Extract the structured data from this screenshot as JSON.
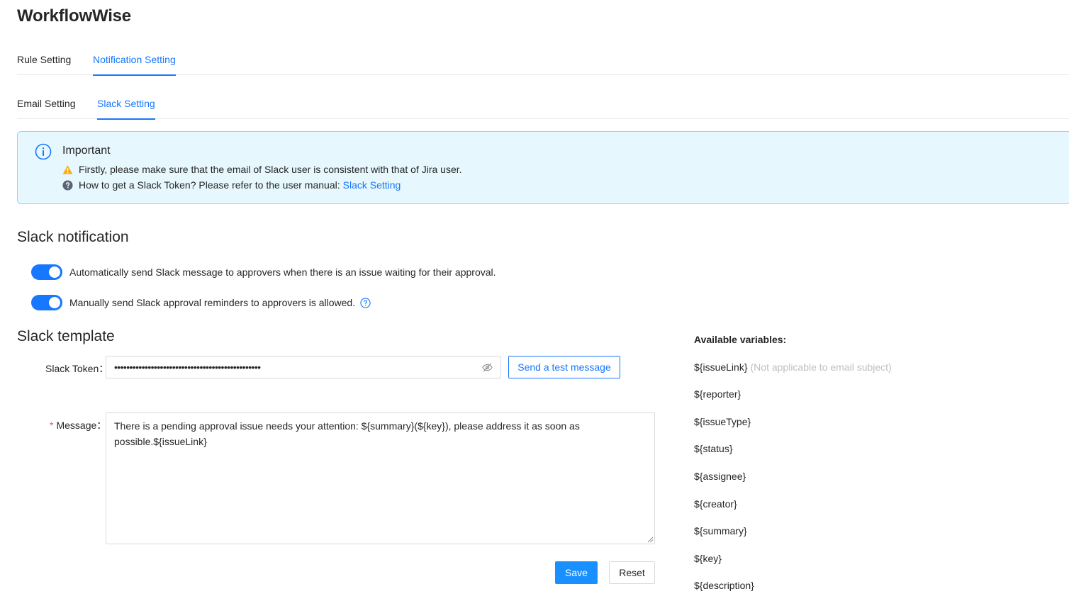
{
  "app": {
    "title": "WorkflowWise"
  },
  "main_tabs": [
    {
      "label": "Rule Setting",
      "active": false
    },
    {
      "label": "Notification Setting",
      "active": true
    }
  ],
  "sub_tabs": [
    {
      "label": "Email Setting",
      "active": false
    },
    {
      "label": "Slack Setting",
      "active": true
    }
  ],
  "alert": {
    "title": "Important",
    "line1": "Firstly, please make sure that the email of Slack user is consistent with that of Jira user.",
    "line2_prefix": "How to get a Slack Token? Please refer to the user manual:",
    "line2_link": "Slack Setting"
  },
  "notification": {
    "title": "Slack notification",
    "auto_send": {
      "label": "Automatically send Slack message to approvers when there is an issue waiting for their approval.",
      "enabled": true
    },
    "manual_reminder": {
      "label": "Manually send Slack approval reminders to approvers is allowed.",
      "enabled": true
    }
  },
  "template": {
    "title": "Slack template",
    "token_label": "Slack Token",
    "token_value": "••••••••••••••••••••••••••••••••••••••••••••••••",
    "test_button": "Send a test message",
    "message_label": "Message",
    "message_value": "There is a pending approval issue needs your attention: ${summary}(${key}), please address it as soon as possible.${issueLink}",
    "save_button": "Save",
    "reset_button": "Reset"
  },
  "variables": {
    "title": "Available variables:",
    "items": [
      {
        "name": "${issueLink}",
        "note": "(Not applicable to email subject)"
      },
      {
        "name": "${reporter}",
        "note": ""
      },
      {
        "name": "${issueType}",
        "note": ""
      },
      {
        "name": "${status}",
        "note": ""
      },
      {
        "name": "${assignee}",
        "note": ""
      },
      {
        "name": "${creator}",
        "note": ""
      },
      {
        "name": "${summary}",
        "note": ""
      },
      {
        "name": "${key}",
        "note": ""
      },
      {
        "name": "${description}",
        "note": ""
      }
    ]
  },
  "colors": {
    "primary": "#1677ff",
    "alert_bg": "#e6f7fd",
    "warning": "#faad14",
    "required": "#ff4d4f"
  }
}
